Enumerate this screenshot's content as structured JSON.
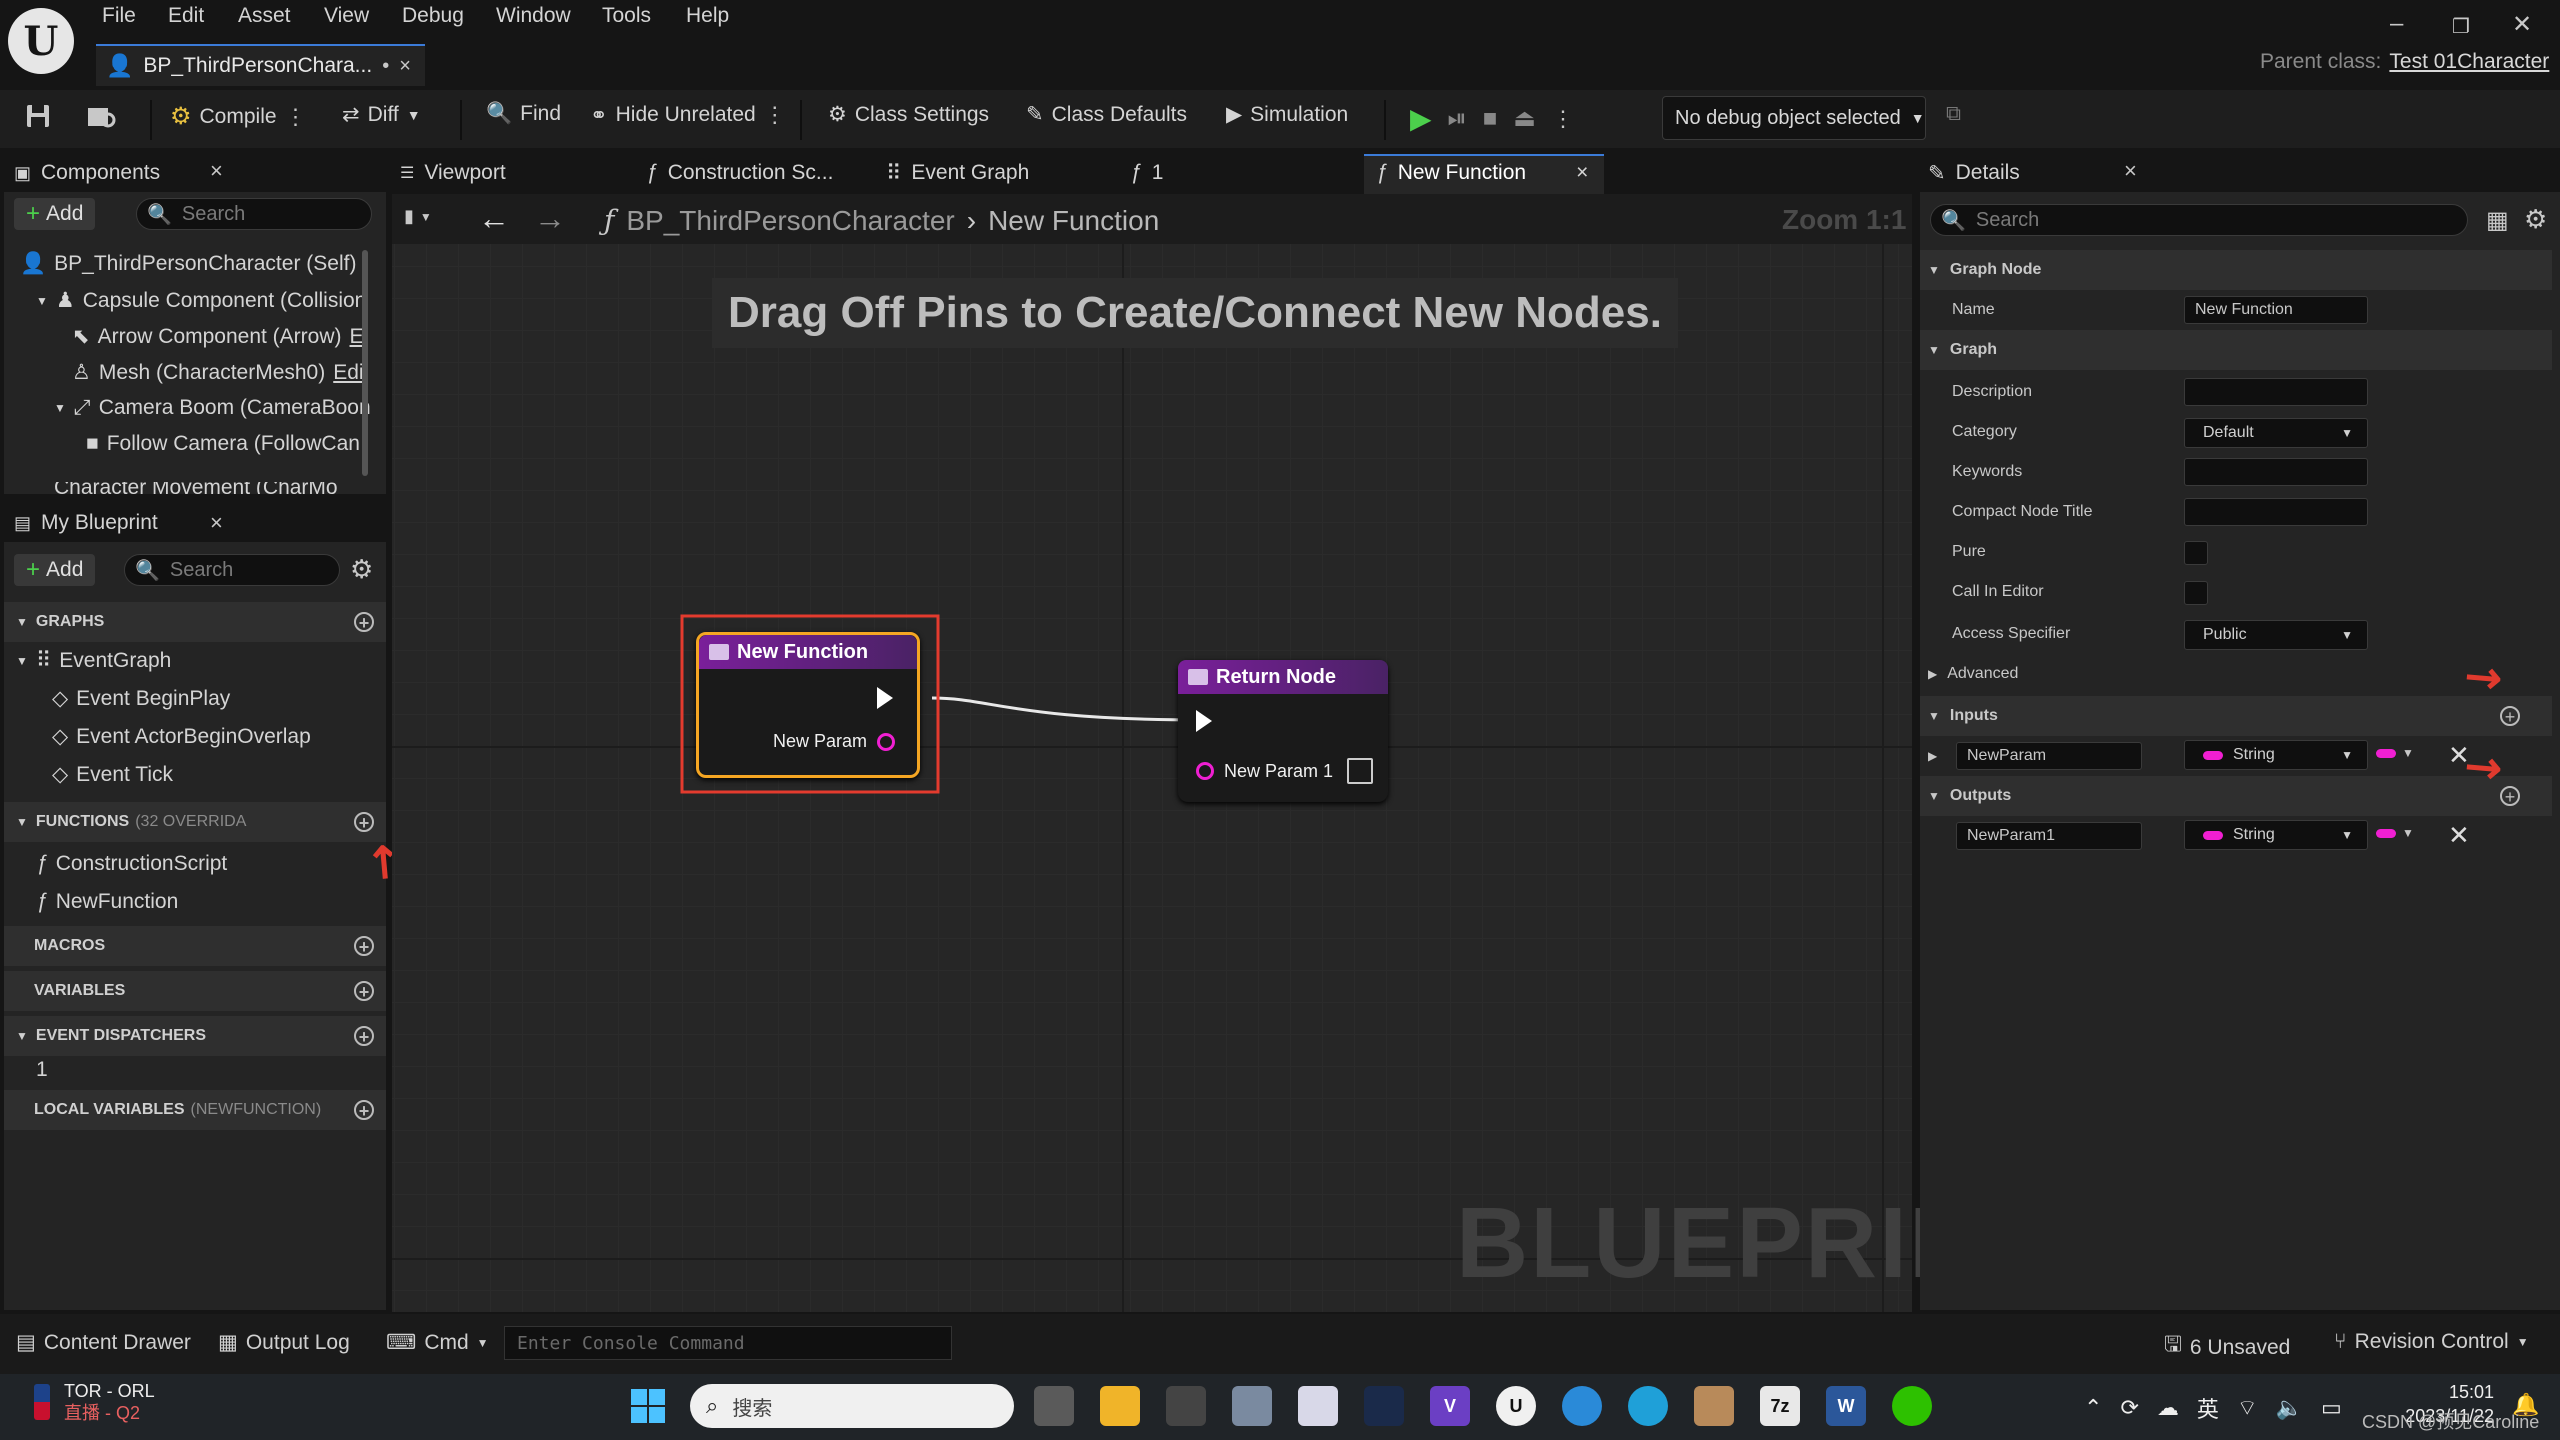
{
  "menu": {
    "items": [
      "File",
      "Edit",
      "Asset",
      "View",
      "Debug",
      "Window",
      "Tools",
      "Help"
    ]
  },
  "document_tab": {
    "title": "BP_ThirdPersonChara...",
    "modified_marker": "•"
  },
  "parent_class": {
    "label": "Parent class:",
    "value": "Test 01Character"
  },
  "toolbar": {
    "compile": "Compile",
    "diff": "Diff",
    "find": "Find",
    "hide_unrelated": "Hide Unrelated",
    "class_settings": "Class Settings",
    "class_defaults": "Class Defaults",
    "simulation": "Simulation",
    "debug_object": "No debug object selected"
  },
  "components_panel": {
    "tab": "Components",
    "add": "Add",
    "search_placeholder": "Search",
    "items": [
      "BP_ThirdPersonCharacter (Self)",
      "Capsule Component (Collision",
      "Arrow Component (Arrow)",
      "Mesh (CharacterMesh0)",
      "Camera Boom (CameraBoon",
      "Follow Camera (FollowCan",
      "Character Movement (CharMo"
    ],
    "arrow_suffix": "E",
    "mesh_suffix": "Edi"
  },
  "my_blueprint": {
    "tab": "My Blueprint",
    "add": "Add",
    "search_placeholder": "Search",
    "graphs_header": "GRAPHS",
    "graphs": [
      "EventGraph",
      "Event BeginPlay",
      "Event ActorBeginOverlap",
      "Event Tick"
    ],
    "functions_header": "FUNCTIONS",
    "functions_sub": "(32 OVERRIDA",
    "functions": [
      "ConstructionScript",
      "NewFunction"
    ],
    "macros_header": "MACROS",
    "variables_header": "VARIABLES",
    "dispatchers_header": "EVENT DISPATCHERS",
    "dispatchers": [
      "1"
    ],
    "local_vars_header": "LOCAL VARIABLES",
    "local_vars_sub": "(NEWFUNCTION)"
  },
  "editor_tabs": [
    "Viewport",
    "Construction Sc...",
    "Event Graph",
    "1",
    "New Function"
  ],
  "graph": {
    "breadcrumb_root": "BP_ThirdPersonCharacter",
    "breadcrumb_leaf": "New Function",
    "zoom": "Zoom 1:1",
    "hint": "Drag Off Pins to Create/Connect New Nodes.",
    "watermark": "BLUEPRINT",
    "entry_node": {
      "title": "New Function",
      "pin": "New Param"
    },
    "return_node": {
      "title": "Return Node",
      "pin": "New Param 1"
    }
  },
  "details": {
    "tab": "Details",
    "search_placeholder": "Search",
    "graph_node_header": "Graph Node",
    "name_label": "Name",
    "name_value": "New Function",
    "graph_header": "Graph",
    "description_label": "Description",
    "category_label": "Category",
    "category_value": "Default",
    "keywords_label": "Keywords",
    "compact_title_label": "Compact Node Title",
    "pure_label": "Pure",
    "call_in_editor_label": "Call In Editor",
    "access_label": "Access Specifier",
    "access_value": "Public",
    "advanced_label": "Advanced",
    "inputs_header": "Inputs",
    "input_name": "NewParam",
    "input_type": "String",
    "outputs_header": "Outputs",
    "output_name": "NewParam1",
    "output_type": "String",
    "pin_color": "#f01fd2"
  },
  "statusbar": {
    "content_drawer": "Content Drawer",
    "output_log": "Output Log",
    "cmd": "Cmd",
    "console_placeholder": "Enter Console Command",
    "unsaved": "6 Unsaved",
    "revision": "Revision Control"
  },
  "taskbar": {
    "score_line1": "TOR - ORL",
    "score_line2": "直播 - Q2",
    "search": "搜索",
    "time": "15:01",
    "date": "2023/11/22",
    "ime": "英",
    "watermark": "CSDN @预见Caroline"
  }
}
